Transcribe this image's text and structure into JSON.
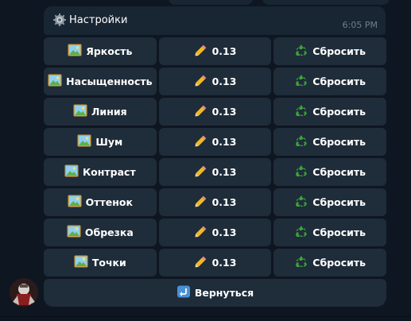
{
  "colors": {
    "background": "#0e1621",
    "bubble": "#182533",
    "button": "#1f2c3a",
    "time_text": "#6d7f8f",
    "text": "#ffffff"
  },
  "message": {
    "icon": "gear-icon",
    "title": "Настройки",
    "time": "6:05 PM"
  },
  "keyboard": {
    "rows": [
      {
        "param": "Яркость",
        "value": "0.13",
        "reset": "Сбросить"
      },
      {
        "param": "Насыщенность",
        "value": "0.13",
        "reset": "Сбросить"
      },
      {
        "param": "Линия",
        "value": "0.13",
        "reset": "Сбросить"
      },
      {
        "param": "Шум",
        "value": "0.13",
        "reset": "Сбросить"
      },
      {
        "param": "Контраст",
        "value": "0.13",
        "reset": "Сбросить"
      },
      {
        "param": "Оттенок",
        "value": "0.13",
        "reset": "Сбросить"
      },
      {
        "param": "Обрезка",
        "value": "0.13",
        "reset": "Сбросить"
      },
      {
        "param": "Точки",
        "value": "0.13",
        "reset": "Сбросить"
      }
    ],
    "param_icon": "picture-icon",
    "value_icon": "pencil-icon",
    "reset_icon": "recycle-icon",
    "back_icon": "return-arrow-icon",
    "back_label": "Вернуться"
  }
}
